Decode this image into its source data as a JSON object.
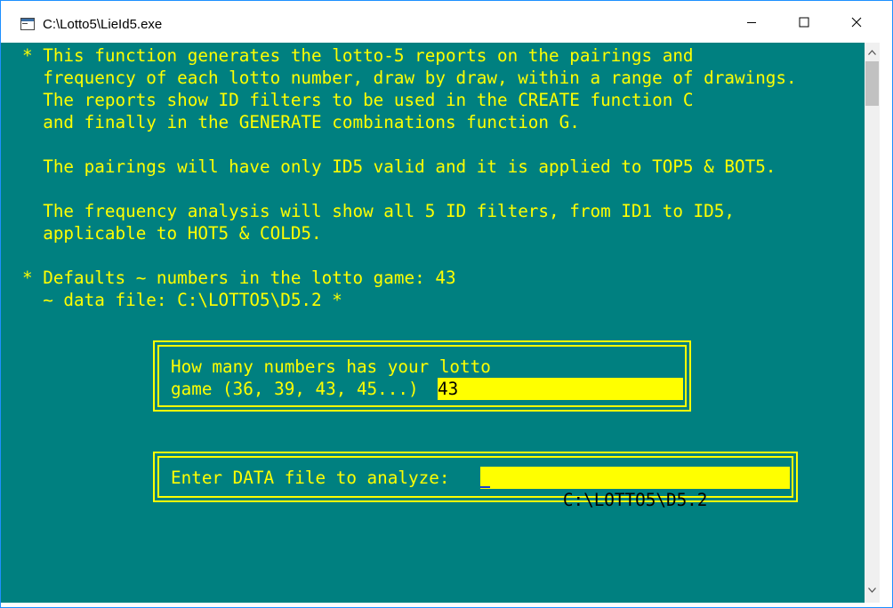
{
  "window": {
    "title": "C:\\Lotto5\\LieId5.exe"
  },
  "console": {
    "lines": [
      "* This function generates the lotto-5 reports on the pairings and",
      "  frequency of each lotto number, draw by draw, within a range of drawings.",
      "  The reports show ID filters to be used in the CREATE function C",
      "  and finally in the GENERATE combinations function G.",
      "",
      "  The pairings will have only ID5 valid and it is applied to TOP5 & BOT5.",
      "",
      "  The frequency analysis will show all 5 ID filters, from ID1 to ID5,",
      "  applicable to HOT5 & COLD5.",
      "",
      "* Defaults ~ numbers in the lotto game: 43",
      "  ~ data file: C:\\LOTTO5\\D5.2 *"
    ]
  },
  "numbers_dialog": {
    "prompt_line1": "How many numbers has your lotto",
    "prompt_line2": "game (36, 39, 43, 45...) ",
    "value": "43"
  },
  "datafile_dialog": {
    "prompt": "Enter DATA file to analyze:",
    "value": "C:\\LOTTO5\\D5.2"
  },
  "colors": {
    "console_bg": "#008080",
    "console_text": "#ffff00",
    "input_bg": "#ffff00",
    "input_text": "#000000"
  }
}
